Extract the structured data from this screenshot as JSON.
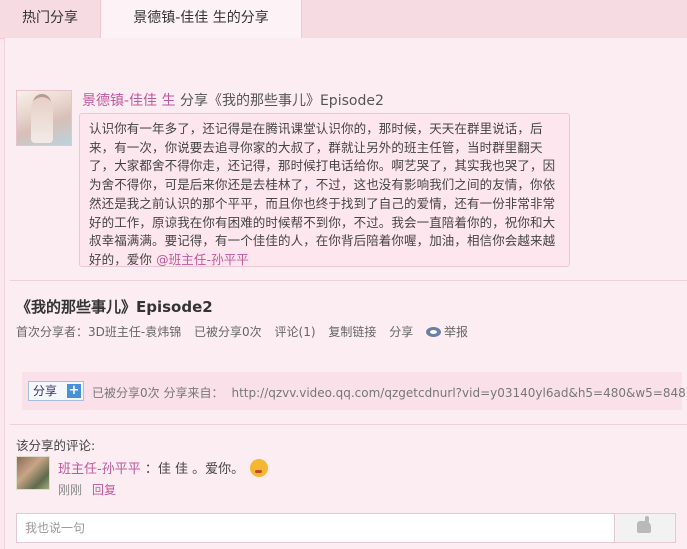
{
  "tabs": [
    {
      "label": "热门分享"
    },
    {
      "label": "景德镇-佳佳 生的分享"
    }
  ],
  "post": {
    "author": "景德镇-佳佳 生",
    "action": " 分享《我的那些事儿》Episode2",
    "body": "认识你有一年多了，还记得是在腾讯课堂认识你的，那时候，天天在群里说话，后来，有一次，你说要去追寻你家的大叔了，群就让另外的班主任管，当时群里翻天了，大家都舍不得你走，还记得，那时候打电话给你。啊艺哭了，其实我也哭了，因为舍不得你，可是后来你还是去桂林了，不过，这也没有影响我们之间的友情，你依然还是我之前认识的那个平平，而且你也终于找到了自己的爱情，还有一份非常非常好的工作，原谅我在你有困难的时候帮不到你，不过。我会一直陪着你的，祝你和大叔幸福满满。要记得，有一个佳佳的人，在你背后陪着你喔，加油，相信你会越来越好的，爱你 ",
    "mention": "@班主任-孙平平"
  },
  "share": {
    "title": "《我的那些事儿》Episode2",
    "first_sharer": "首次分享者：3D班主任-袁炜锦",
    "shared_count": "已被分享0次",
    "comments": "评论(1)",
    "copy_link": "复制链接",
    "share": "分享",
    "report": "举报"
  },
  "share_bar": {
    "button_label": "分享",
    "shared_count": "已被分享0次",
    "source_label": "分享来自：",
    "url": "http://qzvv.video.qq.com/qzgetcdnurl?vid=y03140yl6ad&h5=480&w5=848"
  },
  "comments": {
    "header": "该分享的评论:",
    "items": [
      {
        "author": "班主任-孙平平",
        "sep": "：",
        "text": "佳 佳 。爱你。",
        "time": "刚刚",
        "reply": "回复"
      }
    ]
  },
  "comment_input": {
    "placeholder": "我也说一句"
  },
  "icons": {
    "report": "eye-report-icon",
    "add": "plus-icon",
    "send": "thumb-icon",
    "emoji": "kiss-emoji-icon"
  }
}
